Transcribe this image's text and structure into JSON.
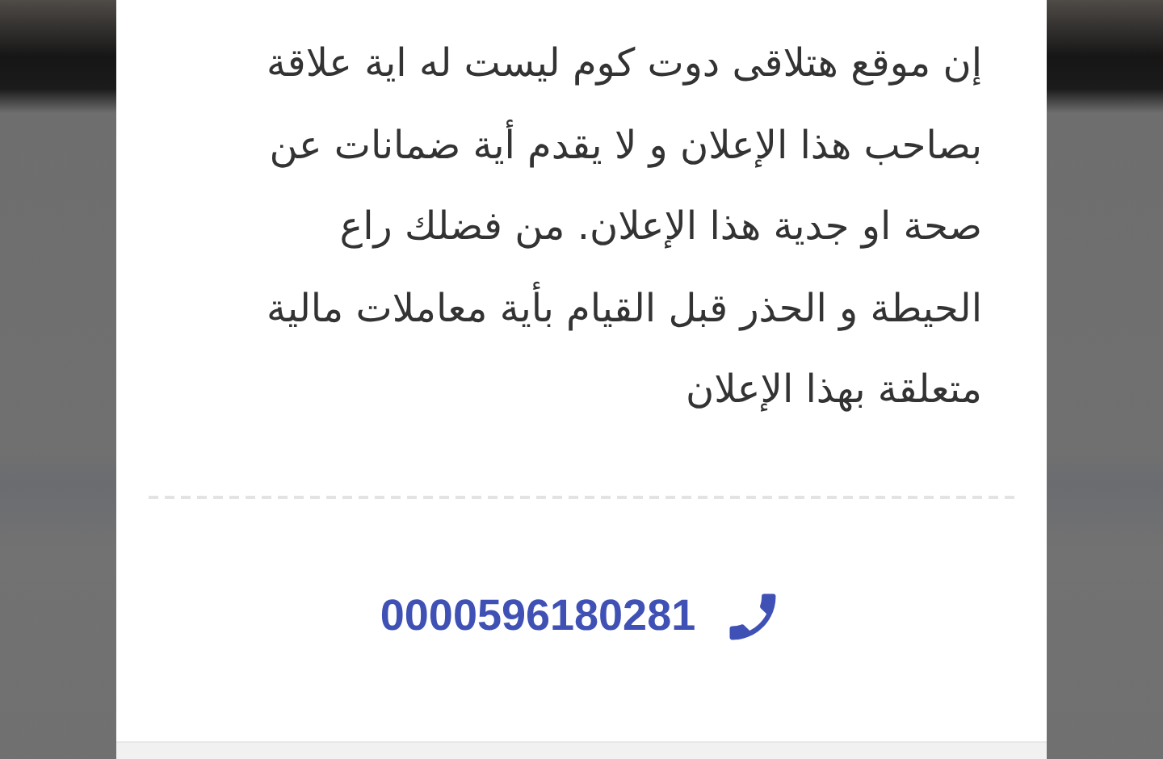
{
  "dialog": {
    "disclaimer": "إن موقع هتلاقى دوت كوم ليست له اية علاقة\nبصاحب هذا الإعلان و لا يقدم أية ضمانات عن\nصحة او جدية هذا الإعلان. من فضلك راع\nالحيطة و الحذر قبل القيام بأية معاملات مالية\nمتعلقة بهذا الإعلان",
    "phone": "0000596180281"
  }
}
